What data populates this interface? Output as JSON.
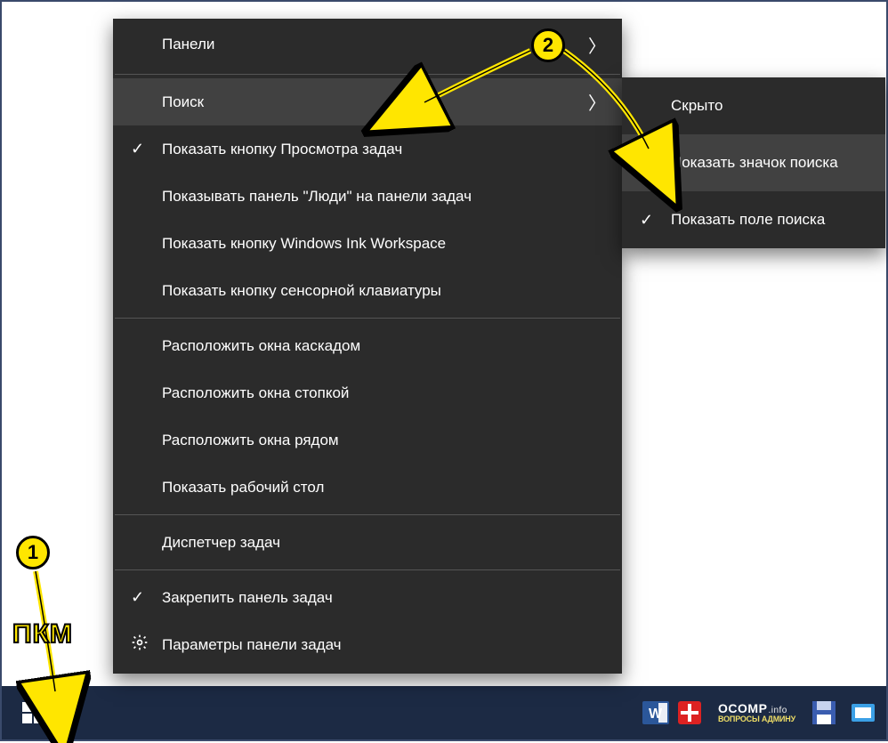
{
  "context_menu": {
    "items": [
      {
        "label": "Панели",
        "has_submenu": true
      },
      {
        "label": "Поиск",
        "has_submenu": true,
        "highlighted": true
      },
      {
        "label": "Показать кнопку Просмотра задач",
        "checked": true
      },
      {
        "label": "Показывать панель \"Люди\" на панели задач"
      },
      {
        "label": "Показать кнопку Windows Ink Workspace"
      },
      {
        "label": "Показать кнопку сенсорной клавиатуры"
      },
      {
        "label": "Расположить окна каскадом"
      },
      {
        "label": "Расположить окна стопкой"
      },
      {
        "label": "Расположить окна рядом"
      },
      {
        "label": "Показать рабочий стол"
      },
      {
        "label": "Диспетчер задач"
      },
      {
        "label": "Закрепить панель задач",
        "checked": true
      },
      {
        "label": "Параметры панели задач",
        "icon": "gear"
      }
    ]
  },
  "submenu": {
    "items": [
      {
        "label": "Скрыто"
      },
      {
        "label": "Показать значок поиска",
        "highlighted": true
      },
      {
        "label": "Показать поле поиска",
        "checked": true
      }
    ]
  },
  "annotations": {
    "marker1": "1",
    "marker2": "2",
    "pkm_label": "ПКМ"
  },
  "watermark": {
    "brand": "OCOMP",
    "suffix": ".info",
    "subtitle": "ВОПРОСЫ АДМИНУ"
  }
}
